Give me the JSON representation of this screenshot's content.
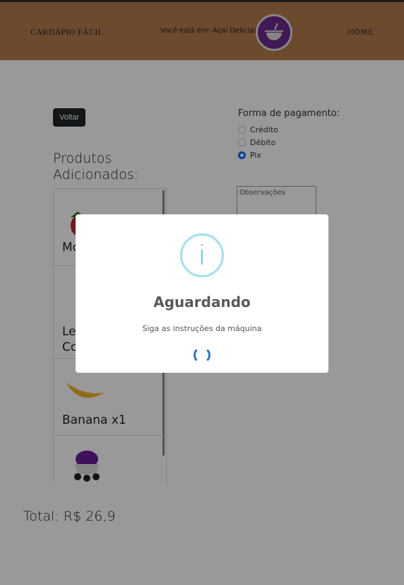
{
  "header": {
    "brand": "CARDÁPIO FÁCIL",
    "location": "Você está em: Açaí Delícias",
    "nav_home": "HOME",
    "logo_icon": "bowl-icon",
    "logo_color": "#6d2a8f"
  },
  "back_label": "Voltar",
  "products": {
    "title": "Produtos Adicionados:",
    "items": [
      {
        "label": "Mo",
        "icon": "strawberry-icon"
      },
      {
        "label": "Le Co",
        "icon": "condensed-milk-icon"
      },
      {
        "label": "Banana x1",
        "icon": "banana-icon"
      },
      {
        "label": "",
        "icon": "acai-bowl-icon"
      }
    ]
  },
  "payment": {
    "title": "Forma de pagamento:",
    "options": [
      "Crédito",
      "Débito",
      "Pix"
    ],
    "selected": "Pix"
  },
  "notes_placeholder": "Observações",
  "total": "Total: R$ 26,9",
  "modal": {
    "icon": "info-icon",
    "icon_glyph": "i",
    "title": "Aguardando",
    "text": "Siga as instruções da máquina"
  }
}
